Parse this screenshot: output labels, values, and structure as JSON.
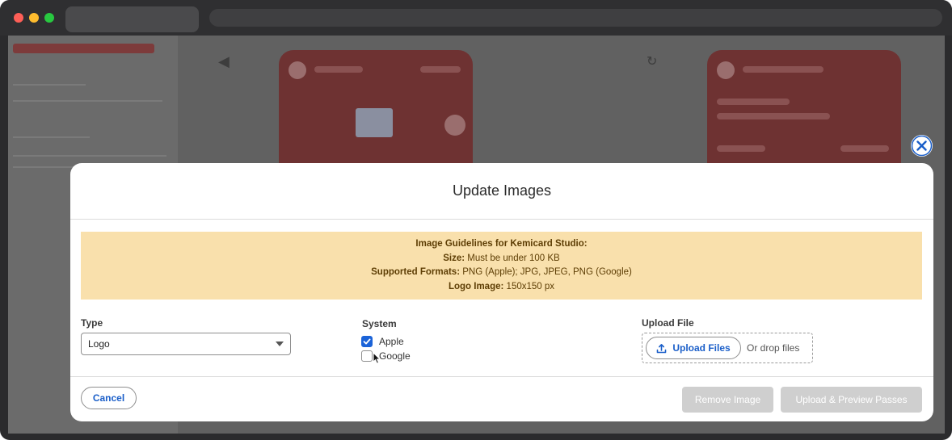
{
  "modal": {
    "title": "Update Images",
    "guidelines": {
      "heading": "Image Guidelines for Kemicard Studio:",
      "size_label": "Size:",
      "size_value": "Must be under 100 KB",
      "formats_label": "Supported Formats:",
      "formats_value": "PNG (Apple); JPG, JPEG, PNG (Google)",
      "logo_label": "Logo Image:",
      "logo_value": "150x150 px"
    },
    "type_field": {
      "label": "Type",
      "selected": "Logo"
    },
    "system_field": {
      "label": "System",
      "options": [
        {
          "label": "Apple",
          "checked": true
        },
        {
          "label": "Google",
          "checked": false
        }
      ]
    },
    "upload_field": {
      "label": "Upload File",
      "button_label": "Upload Files",
      "drop_text": "Or drop files"
    },
    "footer": {
      "cancel_label": "Cancel",
      "remove_label": "Remove Image",
      "upload_preview_label": "Upload & Preview Passes"
    }
  },
  "colors": {
    "accent": "#1b63d8",
    "notice_bg": "#f9e0ac",
    "notice_text": "#5e3e05",
    "disabled_button": "#cfcfcf"
  },
  "icons": [
    "close-icon",
    "upload-icon",
    "checkmark-icon",
    "chevron-down-icon",
    "mouse-cursor-icon"
  ]
}
